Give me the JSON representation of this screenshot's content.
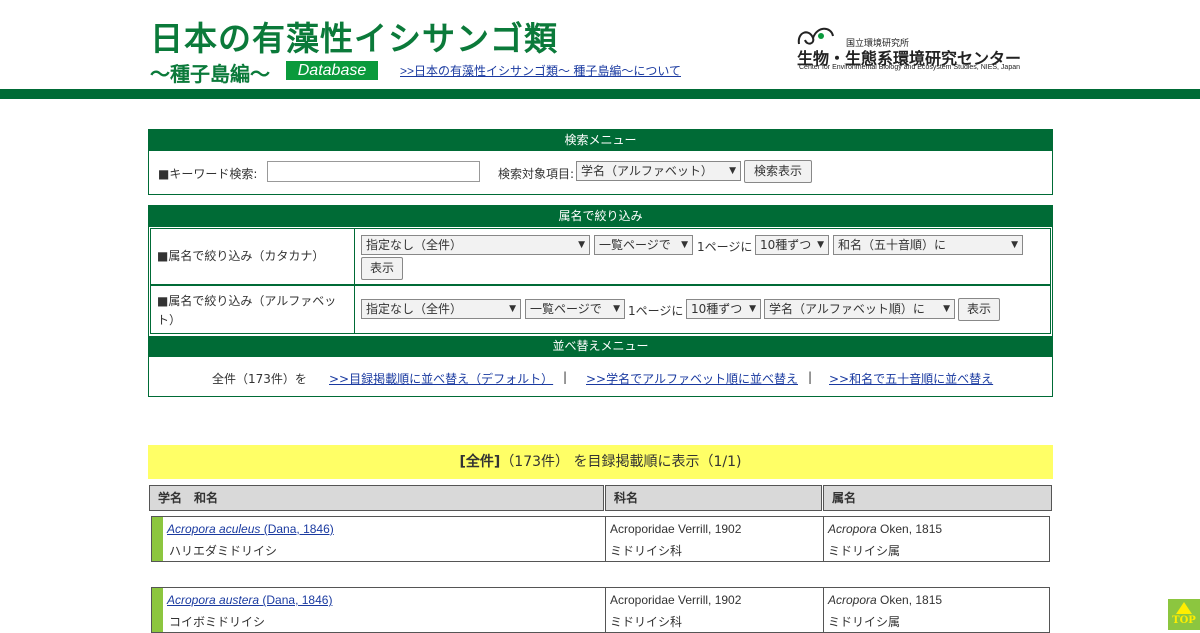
{
  "header": {
    "title": "日本の有藻性イシサンゴ類",
    "subtitle": "〜種子島編〜",
    "badge": "Database",
    "about_link": ">>日本の有藻性イシサンゴ類〜 種子島編〜について",
    "org_small": "国立環境研究所",
    "org_main": "生物・生態系環境研究センター",
    "org_eng": "Center for Environmental Biology and Ecosystem Studies, NIES, Japan"
  },
  "search": {
    "heading": "検索メニュー",
    "keyword_label": "■キーワード検索:",
    "keyword_value": "",
    "target_label": "検索対象項目:",
    "target_selected": "学名（アルファベット）",
    "submit": "検索表示"
  },
  "genus": {
    "heading": "属名で絞り込み",
    "rows": [
      {
        "label": "■属名で絞り込み（カタカナ）",
        "genus_selected": "指定なし（全件）",
        "view_selected": "一覧ページで",
        "per_page_text": "1ページに",
        "count_selected": "10種ずつ",
        "order_selected": "和名（五十音順）に",
        "button": "表示"
      },
      {
        "label": "■属名で絞り込み（アルファベット）",
        "genus_selected": "指定なし（全件）",
        "view_selected": "一覧ページで",
        "per_page_text": "1ページに",
        "count_selected": "10種ずつ",
        "order_selected": "学名（アルファベット順）に",
        "button": "表示"
      }
    ]
  },
  "sort": {
    "heading": "並べ替えメニュー",
    "prefix": "全件（173件）を",
    "links": [
      ">>目録掲載順に並べ替え（デフォルト）",
      ">>学名でアルファベット順に並べ替え",
      ">>和名で五十音順に並べ替え"
    ],
    "separator": "|"
  },
  "result": {
    "bold": "[全件]",
    "rest": "（173件） を目録掲載順に表示（1/1)"
  },
  "table": {
    "headers": [
      "学名　和名",
      "科名",
      "属名"
    ],
    "rows": [
      {
        "sci_italic": "Acropora aculeus",
        "sci_author": " (Dana, 1846) ",
        "jp_name": "ハリエダミドリイシ",
        "family": "Acroporidae Verrill, 1902",
        "family_jp": "ミドリイシ科",
        "genus_italic": "Acropora",
        "genus_author": " Oken, 1815",
        "genus_jp": "ミドリイシ属"
      },
      {
        "sci_italic": "Acropora austera",
        "sci_author": " (Dana, 1846) ",
        "jp_name": "コイボミドリイシ",
        "family": "Acroporidae Verrill, 1902",
        "family_jp": "ミドリイシ科",
        "genus_italic": "Acropora",
        "genus_author": " Oken, 1815",
        "genus_jp": "ミドリイシ属"
      }
    ]
  },
  "top_button": "TOP",
  "colors": {
    "brand_green": "#006b36",
    "title_green": "#0b7a3a",
    "banner_yellow": "#ffff66",
    "row_bar": "#8cc63f",
    "link_blue": "#1a3aa0"
  }
}
